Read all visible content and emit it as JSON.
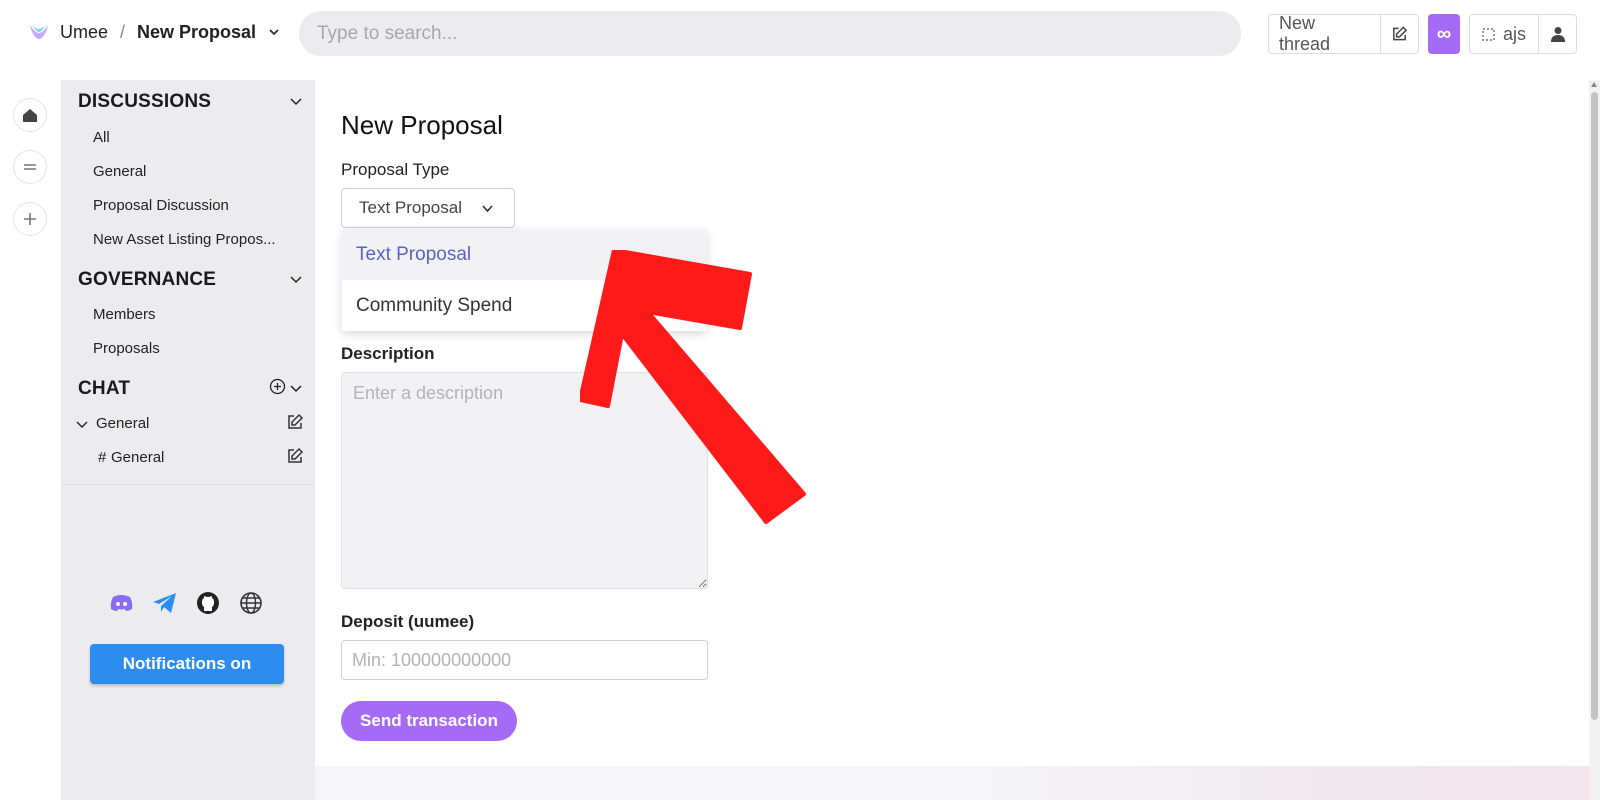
{
  "header": {
    "brand": "Umee",
    "separator": "/",
    "page": "New Proposal",
    "search_placeholder": "Type to search...",
    "new_thread_label": "New thread",
    "infinity_label": "∞",
    "user_label": "ajs"
  },
  "sidebar": {
    "discussions": {
      "title": "DISCUSSIONS",
      "items": [
        "All",
        "General",
        "Proposal Discussion",
        "New Asset Listing Propos..."
      ]
    },
    "governance": {
      "title": "GOVERNANCE",
      "items": [
        "Members",
        "Proposals"
      ]
    },
    "chat": {
      "title": "CHAT",
      "group": "General",
      "channel_hash": "#",
      "channel": "General"
    },
    "notifications_label": "Notifications on"
  },
  "form": {
    "title": "New Proposal",
    "proposal_type_label": "Proposal Type",
    "selected_type": "Text Proposal",
    "options": [
      "Text Proposal",
      "Community Spend"
    ],
    "description_label": "Description",
    "description_placeholder": "Enter a description",
    "deposit_label": "Deposit (uumee)",
    "deposit_placeholder": "Min: 100000000000",
    "submit_label": "Send transaction"
  },
  "colors": {
    "accent": "#a56bf7",
    "notification_blue": "#2d8cf0",
    "selected_option": "#5b61c7",
    "annotation_arrow": "#ff1a1a"
  }
}
